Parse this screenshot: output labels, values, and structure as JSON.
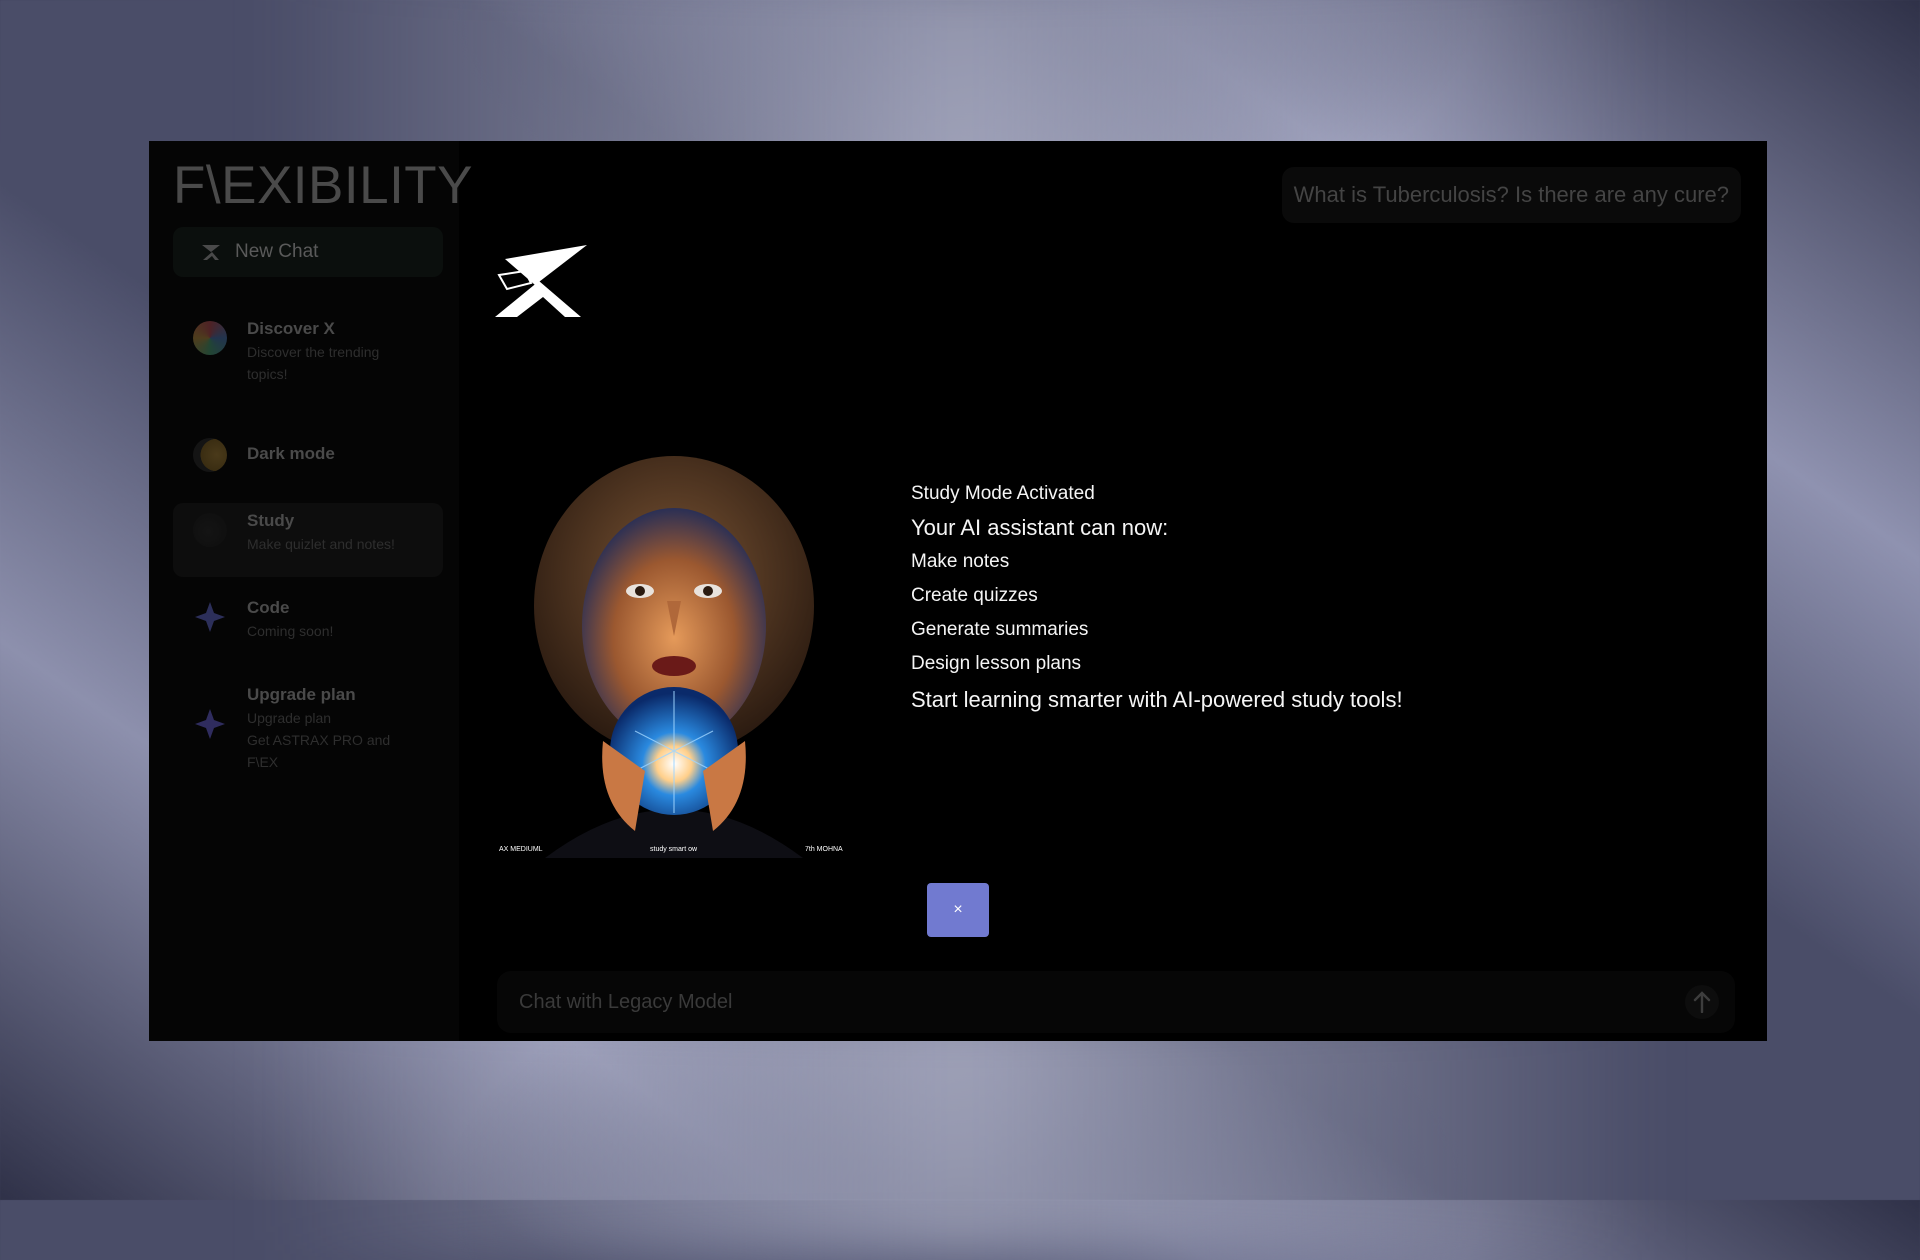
{
  "app": {
    "brand": "F\\EXIBILITY",
    "new_chat_label": "New Chat"
  },
  "sidebar": {
    "items": [
      {
        "title": "Discover X",
        "subtitle": "Discover the trending\ntopics!"
      },
      {
        "title": "Dark mode",
        "subtitle": ""
      },
      {
        "title": "Study",
        "subtitle": "Make quizlet and notes!"
      },
      {
        "title": "Code",
        "subtitle": "Coming soon!"
      },
      {
        "title": "Upgrade plan",
        "subtitle": "Upgrade plan\nGet ASTRAX PRO and\nF\\EX"
      }
    ]
  },
  "main": {
    "top_query": "What is Tuberculosis? Is there are any cure?",
    "chat_placeholder": "Chat with Legacy Model"
  },
  "modal": {
    "title": "Study Mode Activated",
    "heading": "Your AI assistant can now:",
    "items": [
      "Make notes",
      "Create quizzes",
      "Generate summaries",
      "Design lesson plans"
    ],
    "footer": "Start learning smarter with AI-powered study tools!",
    "close_label": "×",
    "poster_captions": [
      "AX MEDIUML",
      "study smart ow",
      "7th MOHNA"
    ]
  },
  "colors": {
    "accent": "#717ad0",
    "window_bg": "#000000",
    "muted_text": "#4a4a4a"
  },
  "icons": [
    "x-logo-icon",
    "orb-icon",
    "moon-icon",
    "apple-icon",
    "sparkle-icon",
    "send-arrow-icon"
  ]
}
